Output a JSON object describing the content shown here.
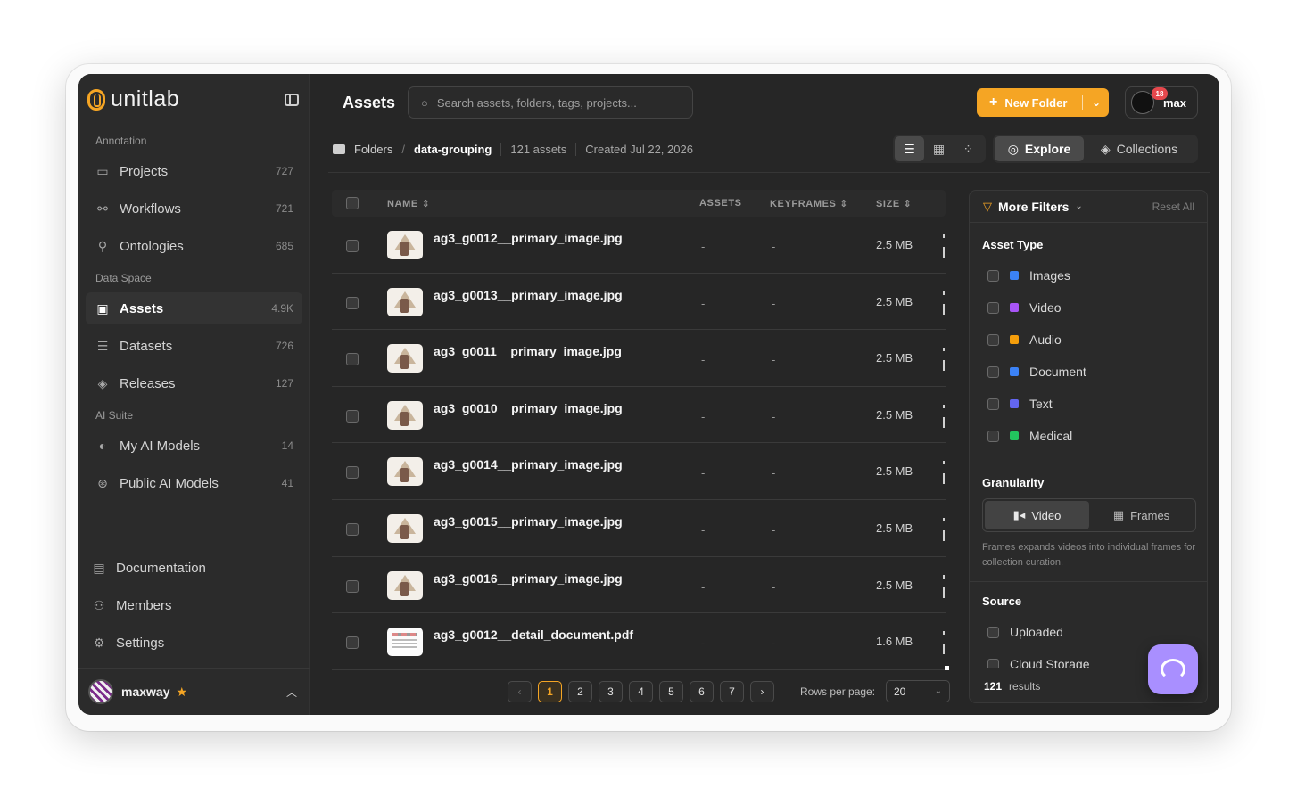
{
  "brand": {
    "name": "unitlab",
    "accent": "#f5a524"
  },
  "sidebar": {
    "sections": [
      {
        "label": "Annotation"
      },
      {
        "label": "Data Space"
      },
      {
        "label": "AI Suite"
      }
    ],
    "items": [
      {
        "label": "Projects",
        "count": "727",
        "icon": "folder-icon"
      },
      {
        "label": "Workflows",
        "count": "721",
        "icon": "workflow-icon"
      },
      {
        "label": "Ontologies",
        "count": "685",
        "icon": "ontology-icon"
      },
      {
        "label": "Assets",
        "count": "4.9K",
        "icon": "assets-icon",
        "active": true
      },
      {
        "label": "Datasets",
        "count": "726",
        "icon": "database-icon"
      },
      {
        "label": "Releases",
        "count": "127",
        "icon": "layers-icon"
      },
      {
        "label": "My AI Models",
        "count": "14",
        "icon": "brain-icon"
      },
      {
        "label": "Public AI Models",
        "count": "41",
        "icon": "globe-icon"
      }
    ],
    "bottom": [
      {
        "label": "Documentation",
        "icon": "document-icon"
      },
      {
        "label": "Members",
        "icon": "members-icon"
      },
      {
        "label": "Settings",
        "icon": "gear-icon"
      }
    ],
    "user": {
      "name": "maxway"
    }
  },
  "header": {
    "title": "Assets",
    "search_placeholder": "Search assets, folders, tags, projects...",
    "new_folder_label": "New Folder",
    "profile_name": "max",
    "notification_count": "18"
  },
  "breadcrumb": {
    "root": "Folders",
    "current": "data-grouping",
    "asset_count": "121 assets",
    "created": "Created Jul 22, 2026"
  },
  "toolbar": {
    "explore_label": "Explore",
    "collections_label": "Collections"
  },
  "table": {
    "columns": [
      "NAME",
      "ASSETS",
      "KEYFRAMES",
      "SIZE"
    ],
    "rows": [
      {
        "name": "ag3_g0012__primary_image.jpg",
        "assets": "-",
        "keyframes": "-",
        "size": "2.5 MB",
        "kind": "image"
      },
      {
        "name": "ag3_g0013__primary_image.jpg",
        "assets": "-",
        "keyframes": "-",
        "size": "2.5 MB",
        "kind": "image"
      },
      {
        "name": "ag3_g0011__primary_image.jpg",
        "assets": "-",
        "keyframes": "-",
        "size": "2.5 MB",
        "kind": "image"
      },
      {
        "name": "ag3_g0010__primary_image.jpg",
        "assets": "-",
        "keyframes": "-",
        "size": "2.5 MB",
        "kind": "image"
      },
      {
        "name": "ag3_g0014__primary_image.jpg",
        "assets": "-",
        "keyframes": "-",
        "size": "2.5 MB",
        "kind": "image"
      },
      {
        "name": "ag3_g0015__primary_image.jpg",
        "assets": "-",
        "keyframes": "-",
        "size": "2.5 MB",
        "kind": "image"
      },
      {
        "name": "ag3_g0016__primary_image.jpg",
        "assets": "-",
        "keyframes": "-",
        "size": "2.5 MB",
        "kind": "image"
      },
      {
        "name": "ag3_g0012__detail_document.pdf",
        "assets": "-",
        "keyframes": "-",
        "size": "1.6 MB",
        "kind": "doc"
      }
    ]
  },
  "pagination": {
    "pages": [
      "1",
      "2",
      "3",
      "4",
      "5",
      "6",
      "7"
    ],
    "current": "1",
    "rows_per_page_label": "Rows per page:",
    "rows_per_page": "20"
  },
  "filters": {
    "title": "More Filters",
    "reset_label": "Reset All",
    "asset_type_title": "Asset Type",
    "asset_types": [
      {
        "label": "Images",
        "color": "#3b82f6"
      },
      {
        "label": "Video",
        "color": "#a855f7"
      },
      {
        "label": "Audio",
        "color": "#f59e0b"
      },
      {
        "label": "Document",
        "color": "#3b82f6"
      },
      {
        "label": "Text",
        "color": "#6366f1"
      },
      {
        "label": "Medical",
        "color": "#22c55e"
      }
    ],
    "granularity_title": "Granularity",
    "granularity": {
      "video_label": "Video",
      "frames_label": "Frames"
    },
    "granularity_note": "Frames expands videos into individual frames for collection curation.",
    "source_title": "Source",
    "sources": [
      {
        "label": "Uploaded"
      },
      {
        "label": "Cloud Storage"
      }
    ],
    "results_count": "121",
    "results_label": "results"
  }
}
